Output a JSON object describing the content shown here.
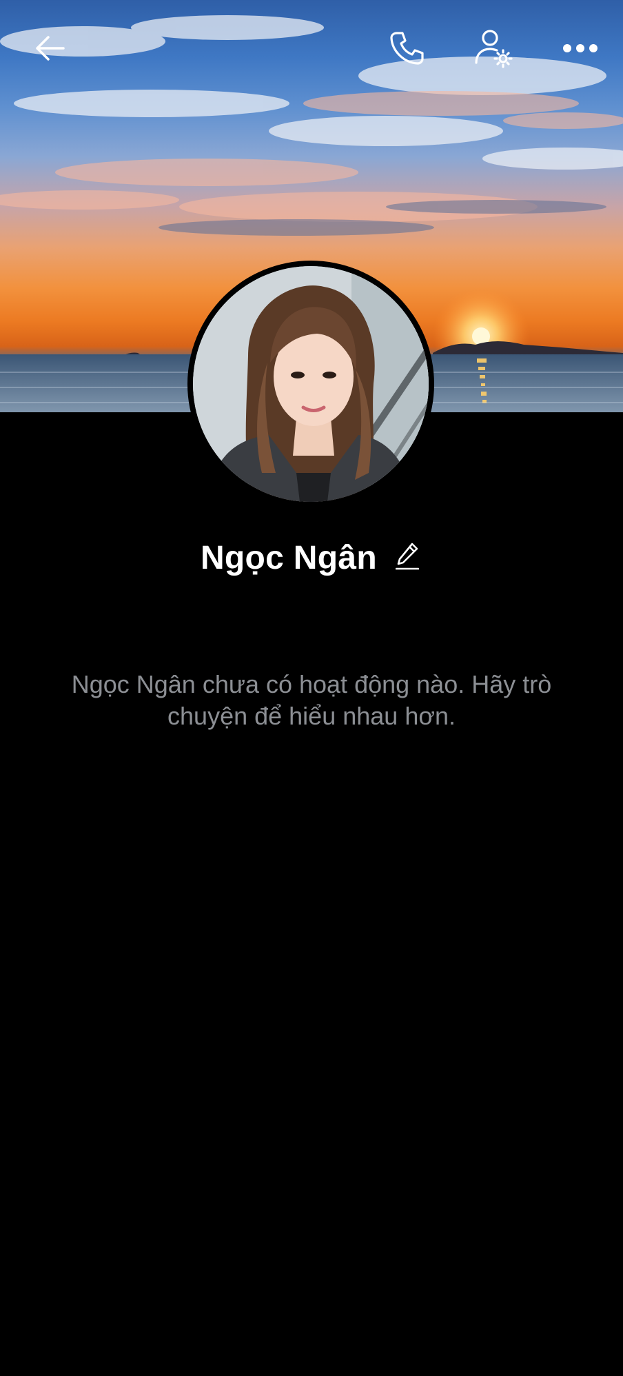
{
  "header": {
    "icons": {
      "back": "arrow-left-icon",
      "call": "phone-icon",
      "settings": "user-settings-icon",
      "more": "more-horizontal-icon"
    }
  },
  "profile": {
    "name": "Ngọc Ngân",
    "edit_icon": "pencil-icon"
  },
  "feed": {
    "empty_message": "Ngọc Ngân chưa có hoạt động nào. Hãy trò chuyện để hiểu nhau hơn."
  },
  "colors": {
    "background": "#000000",
    "name_text": "#ffffff",
    "empty_text": "#8c8f94"
  }
}
